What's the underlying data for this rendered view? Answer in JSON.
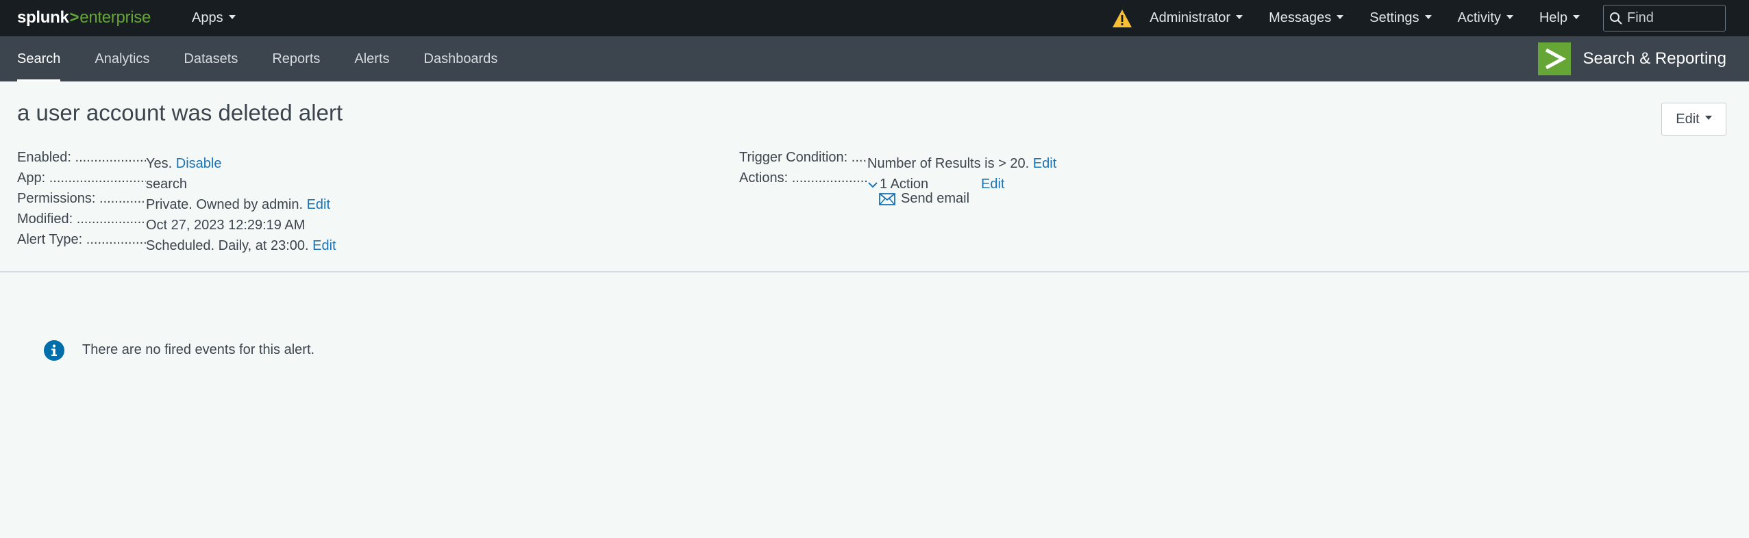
{
  "topbar": {
    "logo_brand": "splunk",
    "logo_gt": ">",
    "logo_product": "enterprise",
    "apps_label": "Apps",
    "menus": [
      "Administrator",
      "Messages",
      "Settings",
      "Activity",
      "Help"
    ],
    "find_placeholder": "Find",
    "warning_icon": "warning-triangle-icon",
    "search_icon": "search-icon"
  },
  "appbar": {
    "nav": [
      "Search",
      "Analytics",
      "Datasets",
      "Reports",
      "Alerts",
      "Dashboards"
    ],
    "active_nav": "Search",
    "app_title": "Search & Reporting",
    "app_icon": "chevron-right-icon"
  },
  "alert": {
    "title": "a user account was deleted alert",
    "edit_label": "Edit",
    "left": [
      {
        "key": "Enabled: ..............................",
        "value": "Yes.",
        "link": "Disable"
      },
      {
        "key": "App: ...................................................",
        "value": "search",
        "link": ""
      },
      {
        "key": "Permissions: ..............................",
        "value": "Private. Owned by admin.",
        "link": "Edit"
      },
      {
        "key": "Modified: ..............................",
        "value": "Oct 27, 2023 12:29:19 AM",
        "link": ""
      },
      {
        "key": "Alert Type: ..............................",
        "value": "Scheduled. Daily, at 23:00.",
        "link": "Edit"
      }
    ],
    "right": {
      "trigger_key": "Trigger Condition: ..............................",
      "trigger_value": "Number of Results is > 20.",
      "trigger_link": "Edit",
      "actions_key": "Actions: ..............................",
      "actions_value": "1 Action",
      "actions_link": "Edit",
      "action_item": "Send email",
      "action_item_icon": "envelope-icon"
    }
  },
  "empty_state": {
    "icon": "info-circle-icon",
    "message": "There are no fired events for this alert."
  },
  "colors": {
    "topbar_bg": "#171d21",
    "appbar_bg": "#3c444d",
    "accent_green": "#65a637",
    "link_blue": "#1a73b6",
    "warning_yellow": "#f8be34",
    "page_bg": "#f4f8f6"
  }
}
